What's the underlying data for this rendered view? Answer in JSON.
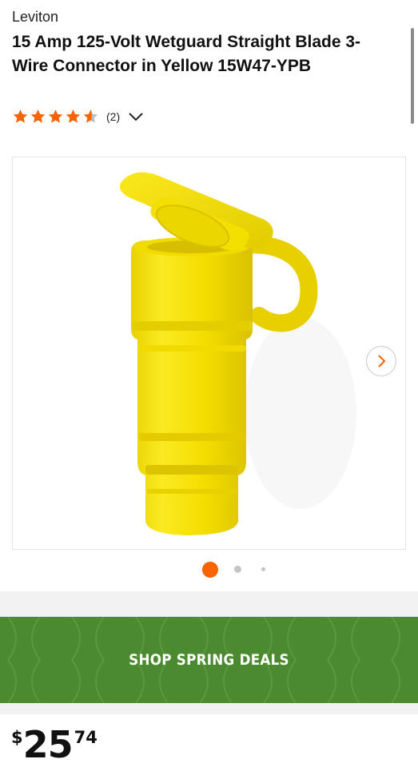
{
  "product": {
    "brand": "Leviton",
    "title": "15 Amp 125-Volt Wetguard Straight Blade 3-Wire Connector in Yellow 15W47-YPB",
    "rating": 4.5,
    "review_count": "(2)",
    "image_alt": "Yellow Wetguard connector with open hinged cap"
  },
  "gallery": {
    "active_index": 0,
    "dot_count": 3
  },
  "promo": {
    "label": "SHOP SPRING DEALS",
    "bg_color": "#4c8a32"
  },
  "price": {
    "currency": "$",
    "dollars": "25",
    "cents": "74"
  },
  "colors": {
    "star": "#f96302",
    "star_empty": "#bdbdbd",
    "dot_active": "#f96302",
    "dot_inactive": "#c4c4c4",
    "product_yellow": "#f5e000"
  },
  "icons": {
    "rating_expand": "chevron-down-icon",
    "next_image": "chevron-right-icon"
  }
}
